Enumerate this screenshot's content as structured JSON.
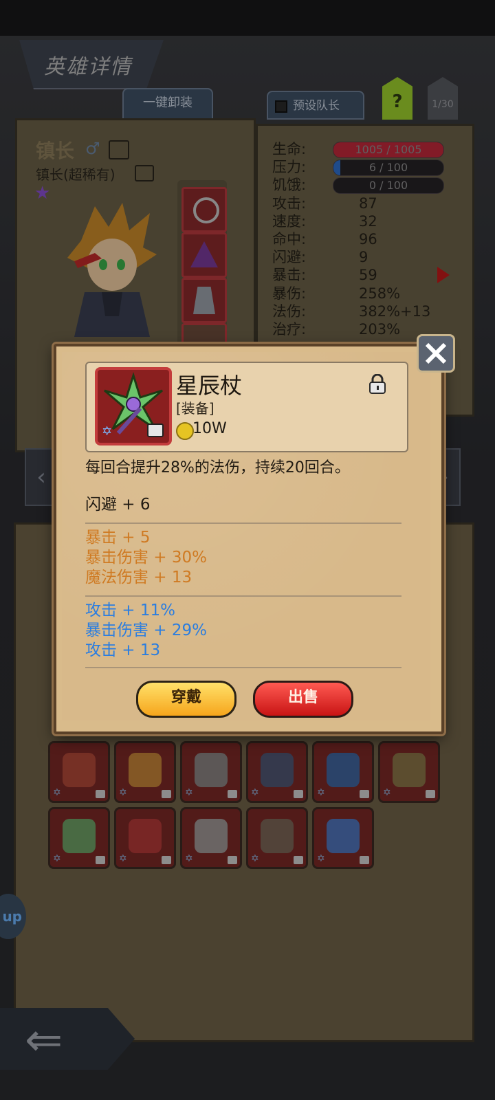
{
  "header": {
    "title": "英雄详情",
    "unequip_all": "一键卸装",
    "preset_captain": "预设队长",
    "help": "?",
    "count": "1/30"
  },
  "hero": {
    "name": "镇长",
    "subtitle": "镇长(超稀有)"
  },
  "stats": [
    {
      "label": "生命:",
      "value": "1005 / 1005",
      "bar": true,
      "fraction": 1.0,
      "color": "#c0283a"
    },
    {
      "label": "压力:",
      "value": "6 / 100",
      "bar": true,
      "fraction": 0.06,
      "color": "#2f6fcc"
    },
    {
      "label": "饥饿:",
      "value": "0 / 100",
      "bar": true,
      "fraction": 0.0,
      "color": "#d89a2a"
    },
    {
      "label": "攻击:",
      "value": "87"
    },
    {
      "label": "速度:",
      "value": "32"
    },
    {
      "label": "命中:",
      "value": "96"
    },
    {
      "label": "闪避:",
      "value": "9"
    },
    {
      "label": "暴击:",
      "value": "59"
    },
    {
      "label": "暴伤:",
      "value": "258%"
    },
    {
      "label": "法伤:",
      "value": "382%+13"
    },
    {
      "label": "治疗:",
      "value": "203%"
    }
  ],
  "popup": {
    "item_name": "星辰杖",
    "item_type": "[装备]",
    "price": "10W",
    "description": "每回合提升28%的法伤，持续20回合。",
    "base_stats": [
      "闪避 + 6"
    ],
    "orange_stats": [
      "暴击 + 5",
      "暴击伤害 + 30%",
      "魔法伤害 + 13"
    ],
    "blue_stats": [
      "攻击 + 11%",
      "暴击伤害 + 29%",
      "攻击 + 13"
    ],
    "equip_label": "穿戴",
    "sell_label": "出售"
  },
  "side_button": "up",
  "colors": {
    "accent_orange": "#cf7a22",
    "accent_blue": "#2a7de0"
  }
}
